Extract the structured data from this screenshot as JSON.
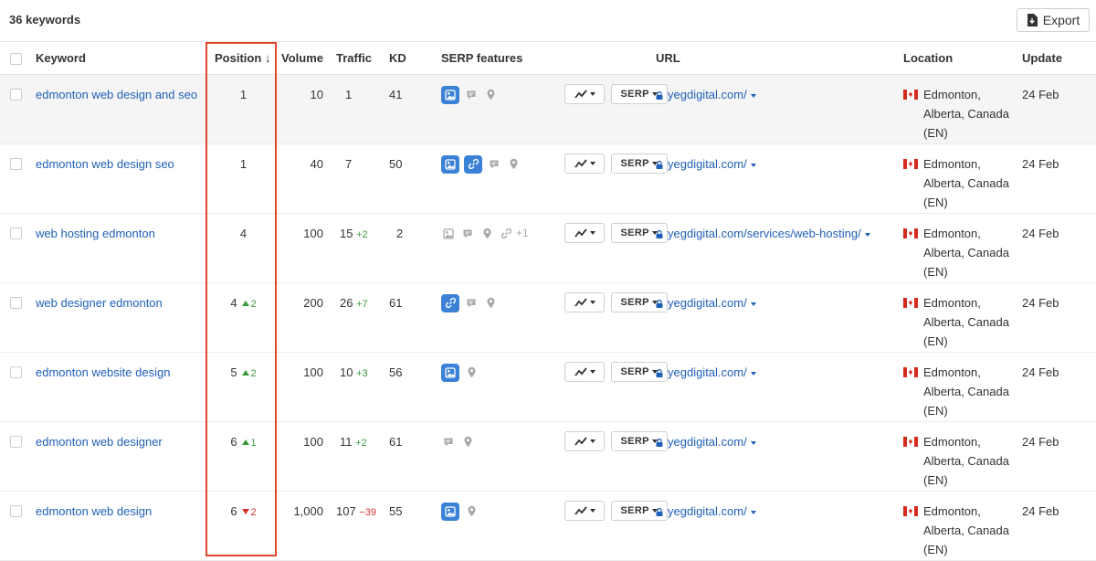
{
  "summary": {
    "keyword_count": "36 keywords"
  },
  "toolbar": {
    "export_label": "Export",
    "export_icon": "file-export-icon"
  },
  "columns": {
    "keyword": "Keyword",
    "position": "Position",
    "sort_arrow": "↓",
    "volume": "Volume",
    "traffic": "Traffic",
    "kd": "KD",
    "serp_features": "SERP features",
    "url": "URL",
    "location": "Location",
    "update": "Update"
  },
  "serp_button_label": "SERP",
  "location": {
    "line1": "Edmonton,",
    "line2": "Alberta, Canada",
    "line3": "(EN)",
    "flag": "canada-flag"
  },
  "highlight": {
    "color": "#e0462c",
    "column": "Position"
  },
  "colors": {
    "link": "#1f5fb8",
    "up": "#3a9a3a",
    "down": "#d0312d",
    "feature_active": "#3b82d6"
  },
  "rows": [
    {
      "keyword": "edmonton web design and seo",
      "position": "1",
      "pos_change": "",
      "pos_dir": "",
      "volume": "10",
      "traffic": "1",
      "traffic_change": "",
      "traffic_dir": "",
      "kd": "41",
      "url": "yegdigital.com/",
      "update": "24 Feb",
      "features": [
        "image-pack-active",
        "review",
        "local-pack"
      ],
      "more": ""
    },
    {
      "keyword": "edmonton web design seo",
      "position": "1",
      "pos_change": "",
      "pos_dir": "",
      "volume": "40",
      "traffic": "7",
      "traffic_change": "",
      "traffic_dir": "",
      "kd": "50",
      "url": "yegdigital.com/",
      "update": "24 Feb",
      "features": [
        "image-pack-active",
        "sitelinks-active",
        "review",
        "local-pack"
      ],
      "more": ""
    },
    {
      "keyword": "web hosting edmonton",
      "position": "4",
      "pos_change": "",
      "pos_dir": "",
      "volume": "100",
      "traffic": "15",
      "traffic_change": "+2",
      "traffic_dir": "up",
      "kd": "2",
      "url": "yegdigital.com/services/web-hosting/",
      "update": "24 Feb",
      "features": [
        "image-pack",
        "review",
        "local-pack",
        "sitelinks"
      ],
      "more": "+1"
    },
    {
      "keyword": "web designer edmonton",
      "position": "4",
      "pos_change": "2",
      "pos_dir": "up",
      "volume": "200",
      "traffic": "26",
      "traffic_change": "+7",
      "traffic_dir": "up",
      "kd": "61",
      "url": "yegdigital.com/",
      "update": "24 Feb",
      "features": [
        "sitelinks-active",
        "review",
        "local-pack"
      ],
      "more": ""
    },
    {
      "keyword": "edmonton website design",
      "position": "5",
      "pos_change": "2",
      "pos_dir": "up",
      "volume": "100",
      "traffic": "10",
      "traffic_change": "+3",
      "traffic_dir": "up",
      "kd": "56",
      "url": "yegdigital.com/",
      "update": "24 Feb",
      "features": [
        "image-pack-active",
        "local-pack"
      ],
      "more": ""
    },
    {
      "keyword": "edmonton web designer",
      "position": "6",
      "pos_change": "1",
      "pos_dir": "up",
      "volume": "100",
      "traffic": "11",
      "traffic_change": "+2",
      "traffic_dir": "up",
      "kd": "61",
      "url": "yegdigital.com/",
      "update": "24 Feb",
      "features": [
        "review",
        "local-pack"
      ],
      "more": ""
    },
    {
      "keyword": "edmonton web design",
      "position": "6",
      "pos_change": "2",
      "pos_dir": "down",
      "volume": "1,000",
      "traffic": "107",
      "traffic_change": "−39",
      "traffic_dir": "down",
      "kd": "55",
      "url": "yegdigital.com/",
      "update": "24 Feb",
      "features": [
        "image-pack-active",
        "local-pack"
      ],
      "more": ""
    }
  ]
}
